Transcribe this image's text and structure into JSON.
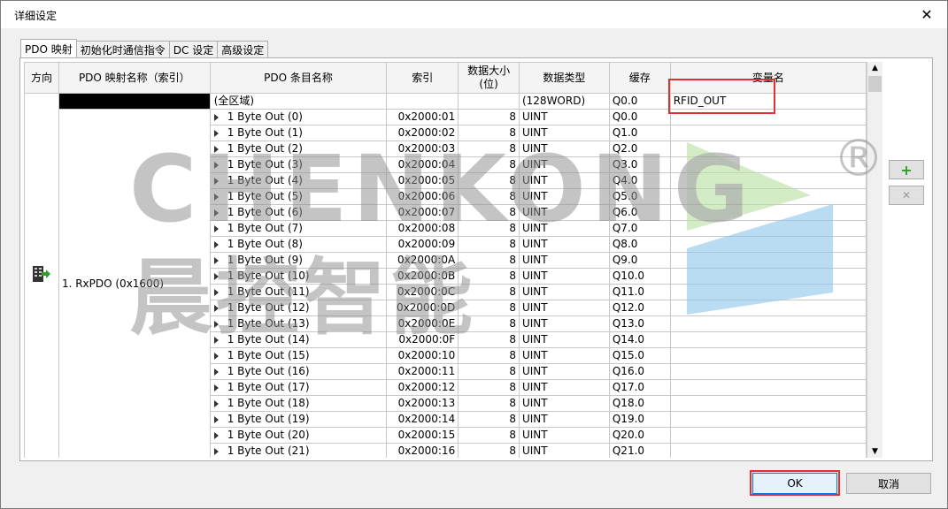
{
  "window": {
    "title": "详细设定",
    "close_label": "✕"
  },
  "tabs": [
    "PDO 映射",
    "初始化时通信指令",
    "DC 设定",
    "高级设定"
  ],
  "table": {
    "headers": [
      "方向",
      "PDO 映射名称（索引）",
      "PDO 条目名称",
      "索引",
      "数据大小\n(位)",
      "数据类型",
      "缓存",
      "变量名"
    ],
    "mapping_name": "1. RxPDO (0x1600)",
    "summary_row": {
      "entry": "(全区域)",
      "type": "(128WORD)",
      "cache": "Q0.0",
      "var": "RFID_OUT"
    },
    "rows": [
      {
        "entry": "1 Byte Out (0)",
        "index": "0x2000:01",
        "size": "8",
        "type": "UINT",
        "cache": "Q0.0"
      },
      {
        "entry": "1 Byte Out (1)",
        "index": "0x2000:02",
        "size": "8",
        "type": "UINT",
        "cache": "Q1.0"
      },
      {
        "entry": "1 Byte Out (2)",
        "index": "0x2000:03",
        "size": "8",
        "type": "UINT",
        "cache": "Q2.0"
      },
      {
        "entry": "1 Byte Out (3)",
        "index": "0x2000:04",
        "size": "8",
        "type": "UINT",
        "cache": "Q3.0"
      },
      {
        "entry": "1 Byte Out (4)",
        "index": "0x2000:05",
        "size": "8",
        "type": "UINT",
        "cache": "Q4.0"
      },
      {
        "entry": "1 Byte Out (5)",
        "index": "0x2000:06",
        "size": "8",
        "type": "UINT",
        "cache": "Q5.0"
      },
      {
        "entry": "1 Byte Out (6)",
        "index": "0x2000:07",
        "size": "8",
        "type": "UINT",
        "cache": "Q6.0"
      },
      {
        "entry": "1 Byte Out (7)",
        "index": "0x2000:08",
        "size": "8",
        "type": "UINT",
        "cache": "Q7.0"
      },
      {
        "entry": "1 Byte Out (8)",
        "index": "0x2000:09",
        "size": "8",
        "type": "UINT",
        "cache": "Q8.0"
      },
      {
        "entry": "1 Byte Out (9)",
        "index": "0x2000:0A",
        "size": "8",
        "type": "UINT",
        "cache": "Q9.0"
      },
      {
        "entry": "1 Byte Out (10)",
        "index": "0x2000:0B",
        "size": "8",
        "type": "UINT",
        "cache": "Q10.0"
      },
      {
        "entry": "1 Byte Out (11)",
        "index": "0x2000:0C",
        "size": "8",
        "type": "UINT",
        "cache": "Q11.0"
      },
      {
        "entry": "1 Byte Out (12)",
        "index": "0x2000:0D",
        "size": "8",
        "type": "UINT",
        "cache": "Q12.0"
      },
      {
        "entry": "1 Byte Out (13)",
        "index": "0x2000:0E",
        "size": "8",
        "type": "UINT",
        "cache": "Q13.0"
      },
      {
        "entry": "1 Byte Out (14)",
        "index": "0x2000:0F",
        "size": "8",
        "type": "UINT",
        "cache": "Q14.0"
      },
      {
        "entry": "1 Byte Out (15)",
        "index": "0x2000:10",
        "size": "8",
        "type": "UINT",
        "cache": "Q15.0"
      },
      {
        "entry": "1 Byte Out (16)",
        "index": "0x2000:11",
        "size": "8",
        "type": "UINT",
        "cache": "Q16.0"
      },
      {
        "entry": "1 Byte Out (17)",
        "index": "0x2000:12",
        "size": "8",
        "type": "UINT",
        "cache": "Q17.0"
      },
      {
        "entry": "1 Byte Out (18)",
        "index": "0x2000:13",
        "size": "8",
        "type": "UINT",
        "cache": "Q18.0"
      },
      {
        "entry": "1 Byte Out (19)",
        "index": "0x2000:14",
        "size": "8",
        "type": "UINT",
        "cache": "Q19.0"
      },
      {
        "entry": "1 Byte Out (20)",
        "index": "0x2000:15",
        "size": "8",
        "type": "UINT",
        "cache": "Q20.0"
      },
      {
        "entry": "1 Byte Out (21)",
        "index": "0x2000:16",
        "size": "8",
        "type": "UINT",
        "cache": "Q21.0"
      }
    ]
  },
  "side_buttons": {
    "add": "+",
    "remove": "✕"
  },
  "buttons": {
    "ok": "OK",
    "cancel": "取消"
  },
  "watermark": {
    "line1": "CHENKONG",
    "line2": "晨控智能",
    "reg": "®"
  },
  "colors": {
    "highlight_box": "#e03030",
    "add_green": "#2e9e2e",
    "wm_green": "#b8e0a0",
    "wm_blue": "#8cc4ea"
  }
}
